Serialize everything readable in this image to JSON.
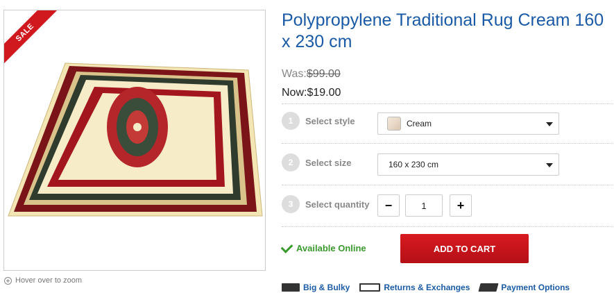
{
  "product": {
    "title": "Polypropylene Traditional Rug Cream 160 x 230 cm",
    "sale_badge": "SALE",
    "zoom_hint": "Hover over to zoom",
    "image_alt_colors": {
      "cream": "#f7ecc8",
      "red": "#a3161d",
      "dark": "#2d2b2b",
      "green": "#4f7b52"
    }
  },
  "pricing": {
    "was_label": "Was:",
    "was_value": "$99.00",
    "now_label": "Now:",
    "now_value": "$19.00"
  },
  "options": {
    "style": {
      "step": "1",
      "label": "Select style",
      "value": "Cream"
    },
    "size": {
      "step": "2",
      "label": "Select size",
      "value": "160 x 230 cm"
    },
    "quantity": {
      "step": "3",
      "label": "Select quantity",
      "value": "1",
      "minus": "−",
      "plus": "+"
    }
  },
  "availability": {
    "text": "Available Online"
  },
  "cart": {
    "label": "ADD TO CART"
  },
  "links": {
    "bulky": "Big & Bulky",
    "returns": "Returns & Exchanges",
    "payment": "Payment Options"
  },
  "colors": {
    "accent_blue": "#1a5aa6",
    "cart_red": "#c4141b",
    "available_green": "#3a9a2e",
    "sale_red": "#d0191f"
  }
}
